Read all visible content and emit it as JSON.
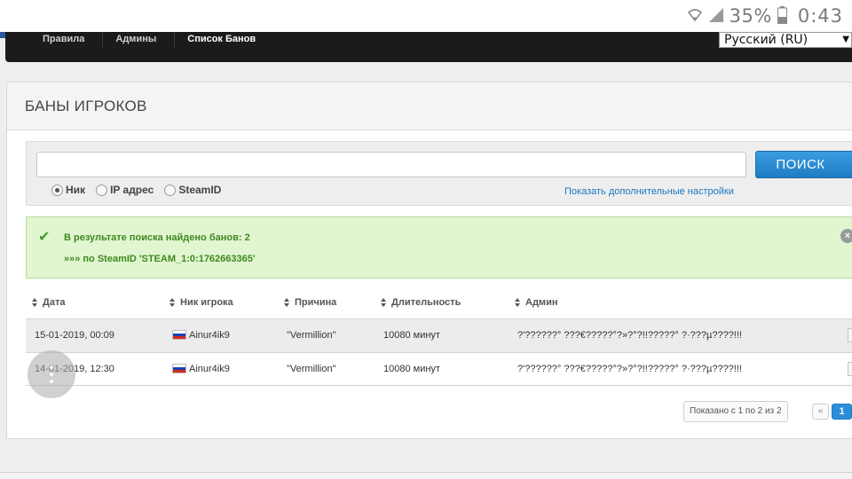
{
  "status_bar": {
    "battery": "35%",
    "time": "0:43"
  },
  "nav": {
    "items": [
      "Правила",
      "Админы",
      "Список Банов"
    ],
    "language": "Русский (RU)"
  },
  "panel": {
    "title": "БАНЫ ИГРОКОВ"
  },
  "search": {
    "input_value": "",
    "button_label": "ПОИСК",
    "options": [
      "Ник",
      "IP адрес",
      "SteamID"
    ],
    "selected_option": "Ник",
    "advanced_link": "Показать дополнительные настройки"
  },
  "alert": {
    "line1": "В результате поиска найдено банов: 2",
    "line2": "»»» по SteamID 'STEAM_1:0:1762663365'"
  },
  "table": {
    "columns": [
      "Дата",
      "Ник игрока",
      "Причина",
      "Длительность",
      "Админ"
    ],
    "rows": [
      {
        "date": "15-01-2019, 00:09",
        "nick": "Ainur4ik9",
        "reason": "\"Vermillion\"",
        "duration": "10080 минут",
        "admin": "?'??????° ???€?????°?»?°?!!?????° ?·???µ????!!!"
      },
      {
        "date": "14-01-2019, 12:30",
        "nick": "Ainur4ik9",
        "reason": "\"Vermillion\"",
        "duration": "10080 минут",
        "admin": "?'??????° ???€?????°?»?°?!!?????° ?·???µ????!!!"
      }
    ]
  },
  "pagination": {
    "info": "Показано с 1 по 2 из 2",
    "prev": "«",
    "current": "1"
  },
  "colors": {
    "nav_bg": "#1b1b1b",
    "accent_blue": "#1f7cc4",
    "alert_bg": "#e1f5d1",
    "alert_text": "#3e8a1e"
  }
}
